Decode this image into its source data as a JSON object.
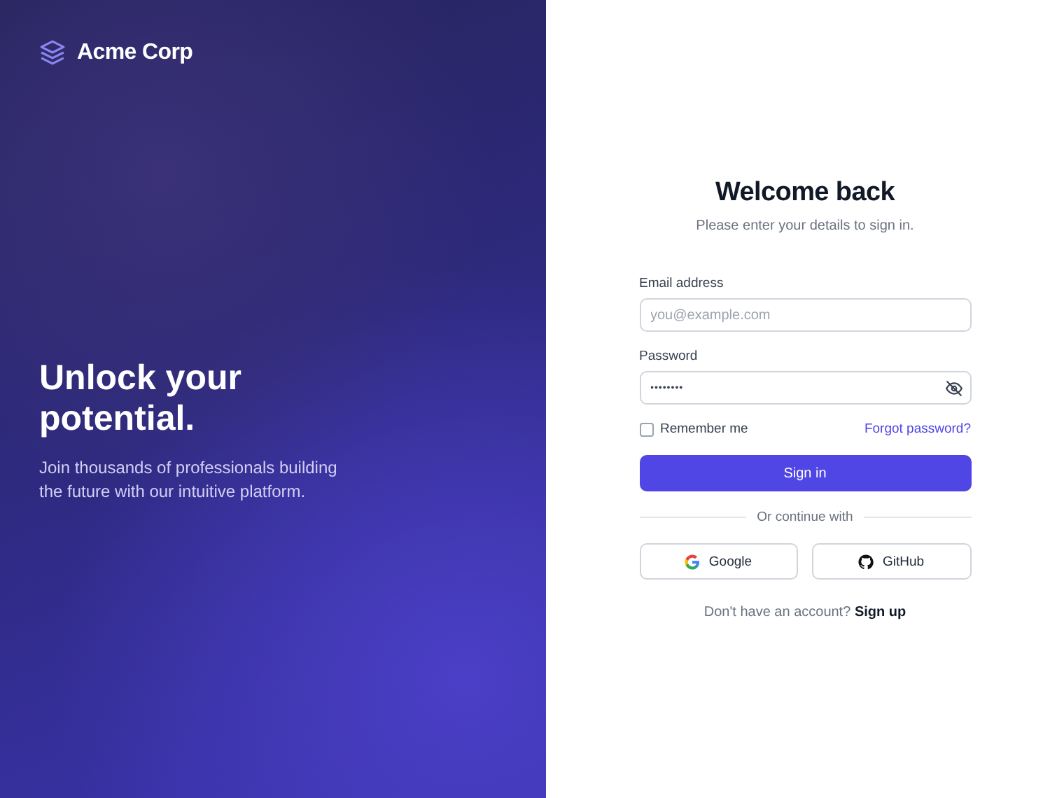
{
  "brand": {
    "name": "Acme Corp"
  },
  "hero": {
    "headline": "Unlock your potential.",
    "text": "Join thousands of professionals building the future with our intuitive platform."
  },
  "form": {
    "title": "Welcome back",
    "subtitle": "Please enter your details to sign in.",
    "fields": [
      {
        "kind": "email",
        "label": "Email address",
        "placeholder": "you@example.com"
      },
      {
        "kind": "password",
        "label": "Password",
        "value": "••••••••"
      }
    ],
    "remember": {
      "label": "Remember me",
      "checked": false
    },
    "forgot_link": "Forgot password?",
    "submit": "Sign in",
    "divider": "Or continue with",
    "social": [
      {
        "kind": "google",
        "label": "Google"
      },
      {
        "kind": "github",
        "label": "GitHub"
      }
    ],
    "signup": {
      "text": "Don't have an account?",
      "link": "Sign up"
    }
  }
}
